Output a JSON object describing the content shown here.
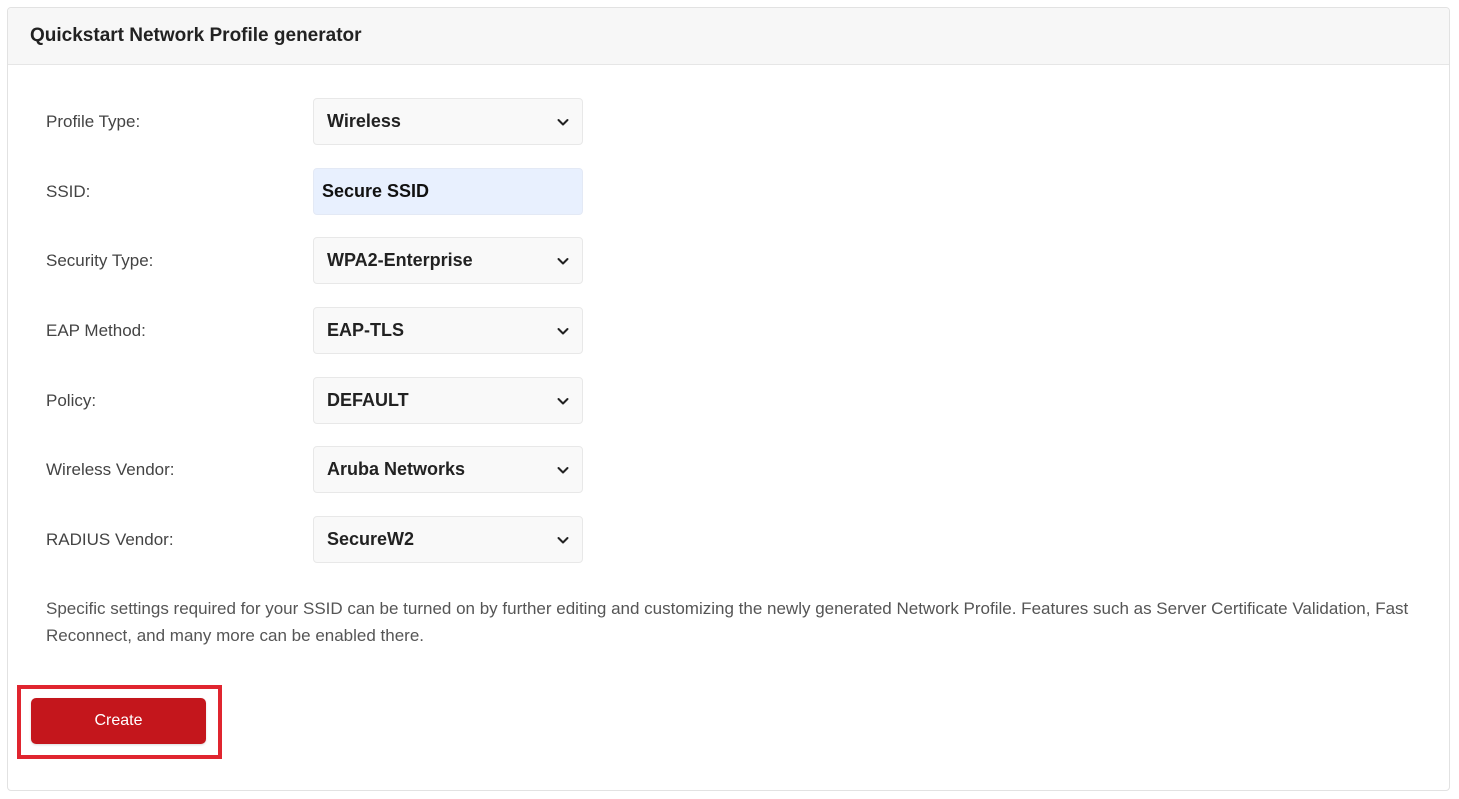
{
  "header": {
    "title": "Quickstart Network Profile generator"
  },
  "form": {
    "profile_type": {
      "label": "Profile Type:",
      "value": "Wireless"
    },
    "ssid": {
      "label": "SSID:",
      "value": "Secure SSID"
    },
    "security_type": {
      "label": "Security Type:",
      "value": "WPA2-Enterprise"
    },
    "eap_method": {
      "label": "EAP Method:",
      "value": "EAP-TLS"
    },
    "policy": {
      "label": "Policy:",
      "value": "DEFAULT"
    },
    "wireless_vendor": {
      "label": "Wireless Vendor:",
      "value": "Aruba Networks"
    },
    "radius_vendor": {
      "label": "RADIUS Vendor:",
      "value": "SecureW2"
    }
  },
  "help_text": "Specific settings required for your SSID can be turned on by further editing and customizing the newly generated Network Profile. Features such as Server Certificate Validation, Fast Reconnect, and many more can be enabled there.",
  "actions": {
    "create_label": "Create"
  },
  "icons": {
    "dropdown": "chevron-down-icon"
  },
  "colors": {
    "primary_button": "#c4161c",
    "highlight_border": "#e0252f",
    "autofill_background": "#e8f0fe"
  }
}
